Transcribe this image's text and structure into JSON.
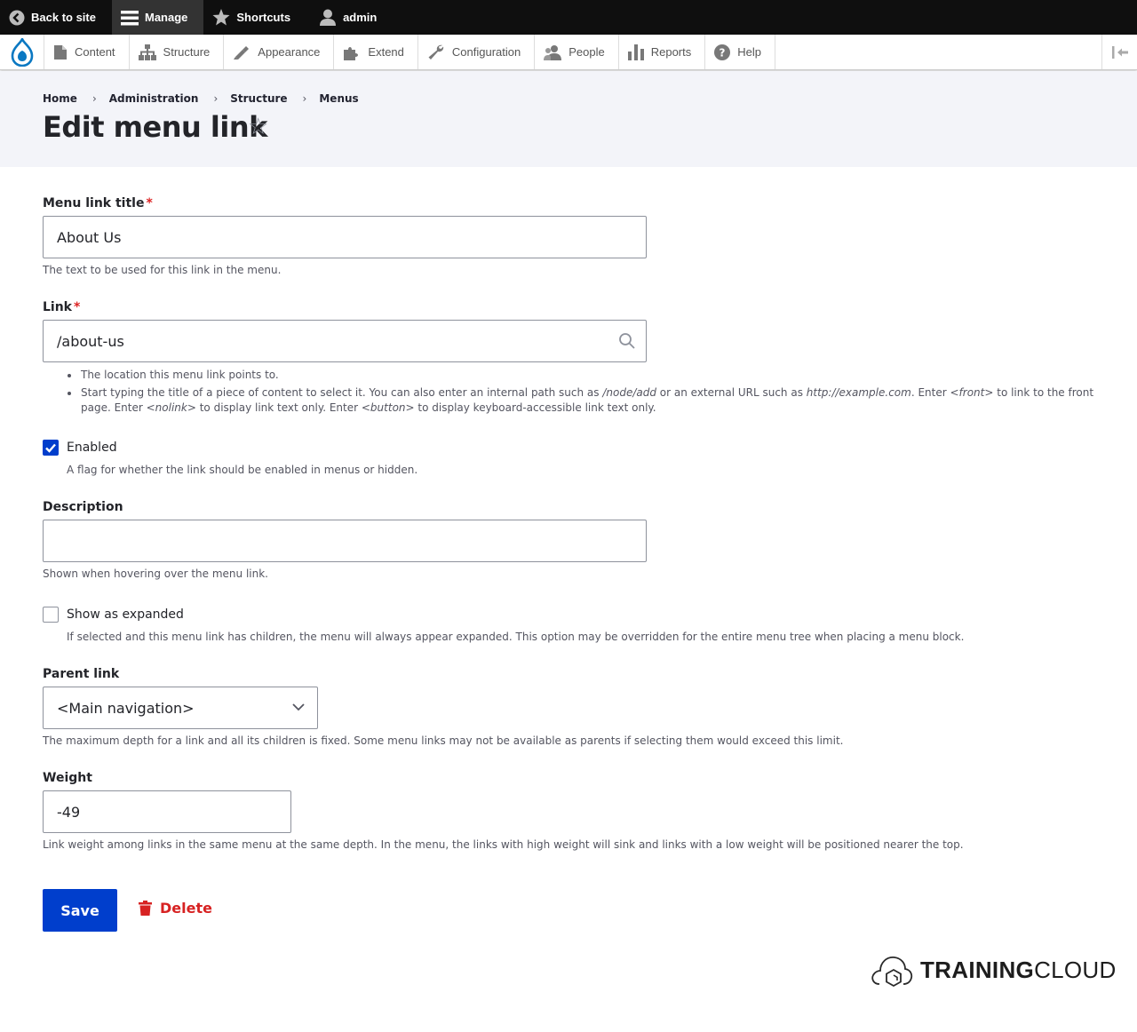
{
  "toolbar": {
    "back_label": "Back to site",
    "manage_label": "Manage",
    "shortcuts_label": "Shortcuts",
    "user_label": "admin"
  },
  "tray": {
    "items": [
      {
        "label": "Content",
        "icon": "file-icon"
      },
      {
        "label": "Structure",
        "icon": "sitemap-icon"
      },
      {
        "label": "Appearance",
        "icon": "paintbrush-icon"
      },
      {
        "label": "Extend",
        "icon": "puzzle-icon"
      },
      {
        "label": "Configuration",
        "icon": "wrench-icon"
      },
      {
        "label": "People",
        "icon": "people-icon"
      },
      {
        "label": "Reports",
        "icon": "bar-chart-icon"
      },
      {
        "label": "Help",
        "icon": "help-icon"
      }
    ]
  },
  "breadcrumb": {
    "items": [
      "Home",
      "Administration",
      "Structure",
      "Menus"
    ],
    "separator": "›"
  },
  "page": {
    "title": "Edit menu link",
    "favorite_glyph": "☆"
  },
  "form": {
    "required_mark": "*",
    "title": {
      "label": "Menu link title",
      "value": "About Us",
      "description": "The text to be used for this link in the menu."
    },
    "link": {
      "label": "Link",
      "value": "/about-us",
      "help_1": "The location this menu link points to.",
      "help_2_a": "Start typing the title of a piece of content to select it. You can also enter an internal path such as ",
      "help_2_b": "/node/add",
      "help_2_c": " or an external URL such as ",
      "help_2_d": "http://example.com",
      "help_2_e": ". Enter ",
      "help_2_f": "<front>",
      "help_2_g": " to link to the front page. Enter ",
      "help_2_h": "<nolink>",
      "help_2_i": " to display link text only. Enter ",
      "help_2_j": "<button>",
      "help_2_k": " to display keyboard-accessible link text only."
    },
    "enabled": {
      "label": "Enabled",
      "checked": true,
      "description": "A flag for whether the link should be enabled in menus or hidden."
    },
    "description_field": {
      "label": "Description",
      "value": "",
      "description": "Shown when hovering over the menu link."
    },
    "expanded": {
      "label": "Show as expanded",
      "checked": false,
      "description": "If selected and this menu link has children, the menu will always appear expanded. This option may be overridden for the entire menu tree when placing a menu block."
    },
    "parent": {
      "label": "Parent link",
      "selected": "<Main navigation>",
      "description": "The maximum depth for a link and all its children is fixed. Some menu links may not be available as parents if selecting them would exceed this limit."
    },
    "weight": {
      "label": "Weight",
      "value": "-49",
      "description": "Link weight among links in the same menu at the same depth. In the menu, the links with high weight will sink and links with a low weight will be positioned nearer the top."
    },
    "save_label": "Save",
    "delete_label": "Delete"
  },
  "brand": {
    "bold": "TRAINING",
    "light": "CLOUD"
  },
  "colors": {
    "primary": "#003ecc",
    "danger": "#d72222",
    "required": "#dc2323",
    "header_bg": "#f3f4f9",
    "toolbar_bg": "#0f0f0f"
  }
}
